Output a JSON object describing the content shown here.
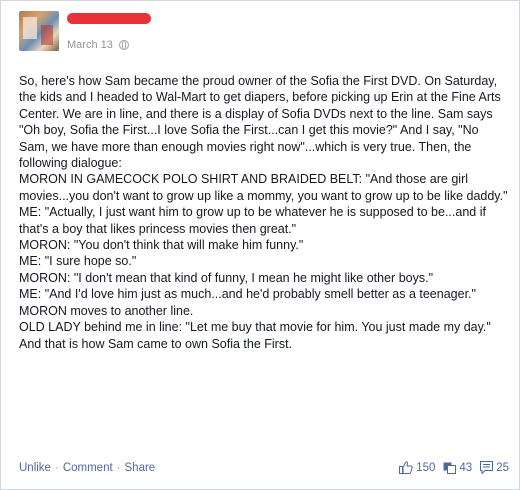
{
  "post": {
    "author_name": "",
    "date": "March 13",
    "privacy_icon": "globe-icon",
    "paragraphs": [
      "So, here's how Sam became the proud owner of the Sofia the First DVD. On Saturday, the kids and I headed to Wal-Mart to get diapers, before picking up Erin at the Fine Arts Center. We are in line, and there is a display of Sofia DVDs next to the line. Sam says \"Oh boy, Sofia the First...I love Sofia the First...can I get this movie?\" And I say, \"No Sam, we have more than enough movies right now\"...which is very true. Then, the following dialogue:",
      "MORON IN GAMECOCK POLO SHIRT AND BRAIDED BELT: \"And those are girl movies...you don't want to grow up like a mommy, you want to grow up to be like daddy.\"",
      "ME: \"Actually, I just want him to grow up to be whatever he is supposed to be...and if that's a boy that likes princess movies then great.\"",
      "MORON: \"You don't think that will make him funny.\"",
      "ME: \"I sure hope so.\"",
      "MORON: \"I don't mean that kind of funny, I mean he might like other boys.\"",
      "ME: \"And I'd love him just as much...and he'd probably smell better as a teenager.\"",
      "MORON moves to another line.",
      "OLD LADY behind me in line: \"Let me buy that movie for him. You just made my day.\"",
      "And that is how Sam came to own Sofia the First."
    ]
  },
  "footer": {
    "unlike_label": "Unlike",
    "comment_label": "Comment",
    "share_label": "Share",
    "separator": "·",
    "likes_count": "150",
    "likes_icon": "thumbs-up-icon",
    "shares_count": "43",
    "shares_icon": "share-icon",
    "comments_count": "25",
    "comments_icon": "comment-icon"
  },
  "colors": {
    "link": "#4e69a2",
    "meta": "#90949c",
    "text": "#141823",
    "redaction": "#e8323a"
  }
}
